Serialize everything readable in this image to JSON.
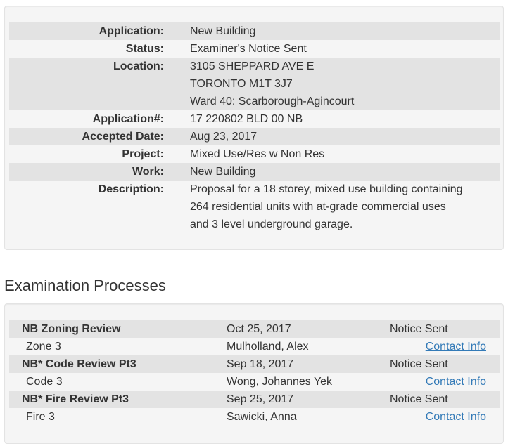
{
  "details": [
    {
      "label": "Application:",
      "lines": [
        "New Building"
      ]
    },
    {
      "label": "Status:",
      "lines": [
        "Examiner's Notice Sent"
      ]
    },
    {
      "label": "Location:",
      "lines": [
        "3105 SHEPPARD AVE E",
        "TORONTO M1T 3J7",
        "Ward 40: Scarborough-Agincourt"
      ]
    },
    {
      "label": "Application#:",
      "lines": [
        "17 220802 BLD 00 NB"
      ]
    },
    {
      "label": "Accepted Date:",
      "lines": [
        "Aug 23, 2017"
      ]
    },
    {
      "label": "Project:",
      "lines": [
        "Mixed Use/Res w Non Res"
      ]
    },
    {
      "label": "Work:",
      "lines": [
        "New Building"
      ]
    },
    {
      "label": "Description:",
      "lines": [
        "Proposal for a 18 storey, mixed use building containing",
        "264 residential units with at-grade commercial uses",
        "and 3 level underground garage."
      ]
    }
  ],
  "section_title": "Examination Processes",
  "processes": [
    {
      "name": "NB Zoning Review",
      "date": "Oct 25, 2017",
      "status": "Notice Sent",
      "sub": "Zone 3",
      "examiner": "Mulholland, Alex",
      "link": "Contact Info"
    },
    {
      "name": "NB* Code Review Pt3",
      "date": "Sep 18, 2017",
      "status": "Notice Sent",
      "sub": "Code 3",
      "examiner": "Wong, Johannes Yek",
      "link": "Contact Info"
    },
    {
      "name": "NB* Fire Review Pt3",
      "date": "Sep 25, 2017",
      "status": "Notice Sent",
      "sub": "Fire 3",
      "examiner": "Sawicki, Anna",
      "link": "Contact Info"
    }
  ]
}
